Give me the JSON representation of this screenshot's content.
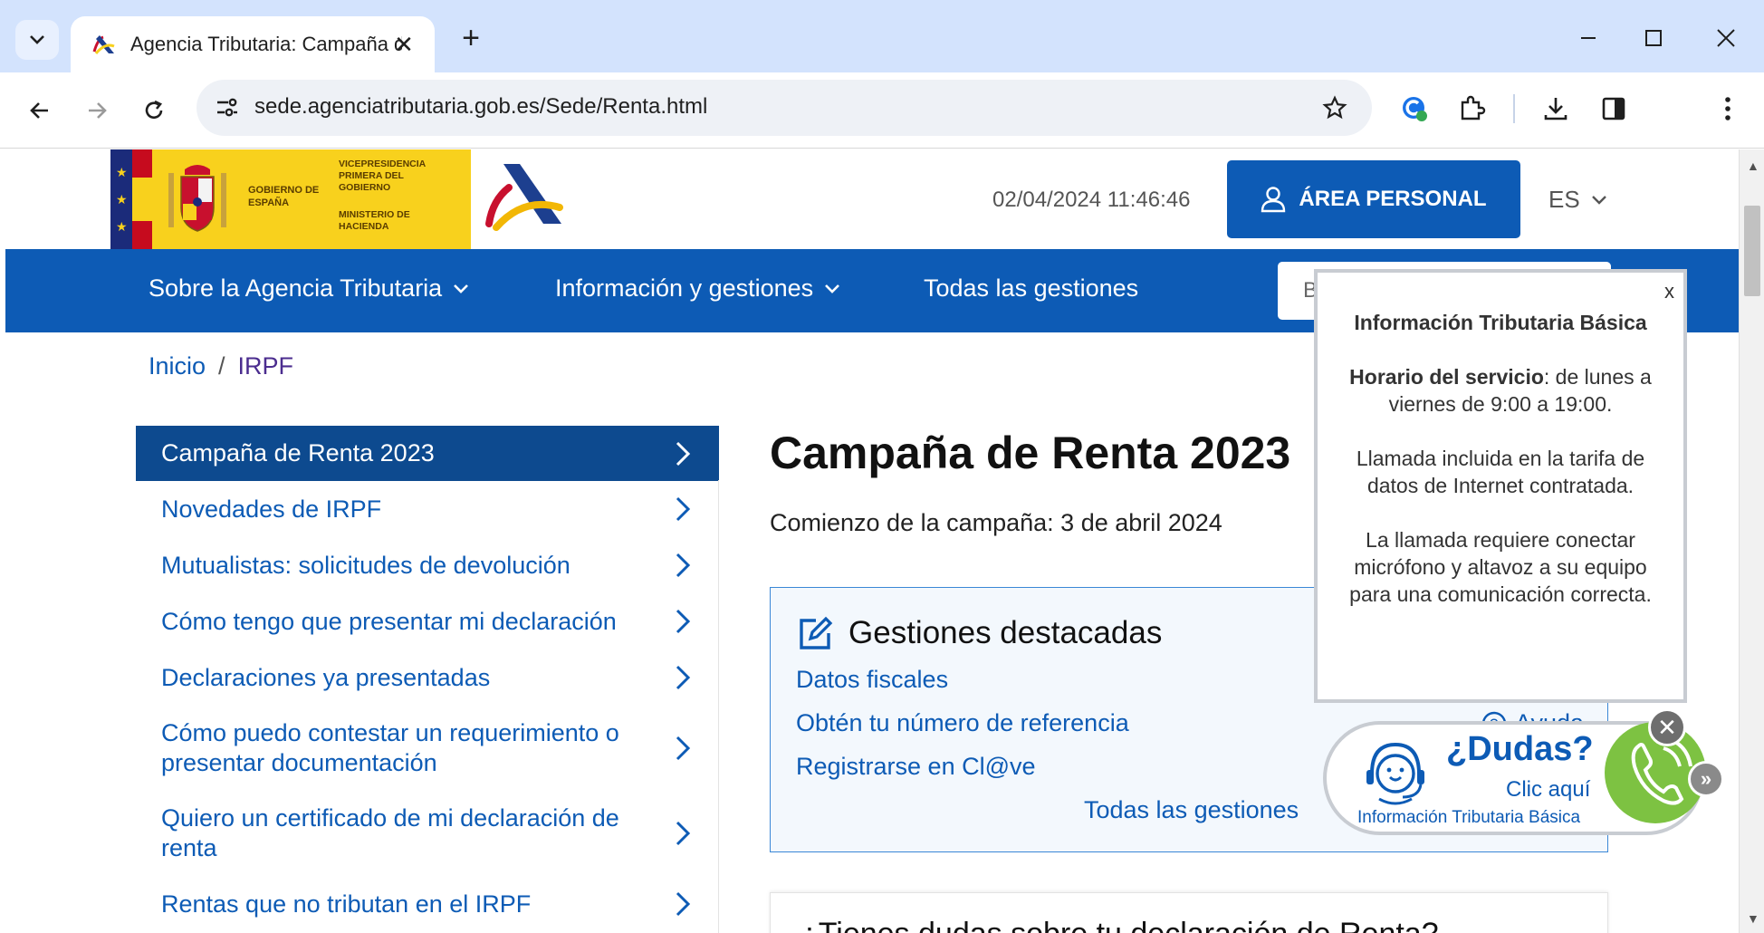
{
  "browser": {
    "tab_title": "Agencia Tributaria: Campaña de",
    "tab_close": "✕",
    "new_tab": "+",
    "url": "sede.agenciatributaria.gob.es/Sede/Renta.html"
  },
  "header": {
    "gob_text": "GOBIERNO DE ESPAÑA",
    "vice_text": "VICEPRESIDENCIA PRIMERA DEL GOBIERNO",
    "min_text": "MINISTERIO DE HACIENDA",
    "datetime": "02/04/2024 11:46:46",
    "area_personal": "ÁREA PERSONAL",
    "lang": "ES"
  },
  "mainnav": {
    "items": [
      {
        "label": "Sobre la Agencia Tributaria"
      },
      {
        "label": "Información y gestiones"
      },
      {
        "label": "Todas las gestiones"
      }
    ],
    "search_placeholder": "B"
  },
  "breadcrumb": {
    "home": "Inicio",
    "sep": "/",
    "current": "IRPF"
  },
  "sidemenu": {
    "items": [
      {
        "label": "Campaña de Renta 2023"
      },
      {
        "label": "Novedades de IRPF"
      },
      {
        "label": "Mutualistas: solicitudes de devolución"
      },
      {
        "label": "Cómo tengo que presentar mi declaración"
      },
      {
        "label": "Declaraciones ya presentadas"
      },
      {
        "label": "Cómo puedo contestar un requerimiento o presentar documentación"
      },
      {
        "label": "Quiero un certificado de mi declaración de renta"
      },
      {
        "label": "Rentas que no tributan en el IRPF"
      }
    ]
  },
  "content": {
    "title": "Campaña de Renta 2023",
    "subtitle": "Comienzo de la campaña: 3 de abril 2024",
    "gestiones": {
      "title": "Gestiones destacadas",
      "links": [
        "Datos fiscales",
        "Obtén tu número de referencia",
        "Registrarse en Cl@ve"
      ],
      "all": "Todas las gestiones",
      "help": "Ayuda"
    },
    "faq_partial": "¿Tienes dudas sobre tu declaración de Renta?"
  },
  "popup": {
    "close": "x",
    "title": "Información Tributaria Básica",
    "horario_label": "Horario del servicio",
    "horario_text": ": de lunes a viernes de 9:00 a 19:00.",
    "p2": "Llamada incluida en la tarifa de datos de Internet contratada.",
    "p3": "La llamada requiere conectar micrófono y altavoz a su equipo para una comunicación correcta."
  },
  "dudas": {
    "title": "¿Dudas?",
    "click": "Clic aquí",
    "info": "Información Tributaria Básica",
    "close": "✕",
    "expand": "»"
  },
  "colors": {
    "brand_blue": "#0d5bb5",
    "active_menu": "#0d4a8f",
    "gob_yellow": "#f8d11d",
    "phone_green": "#7dc242"
  }
}
